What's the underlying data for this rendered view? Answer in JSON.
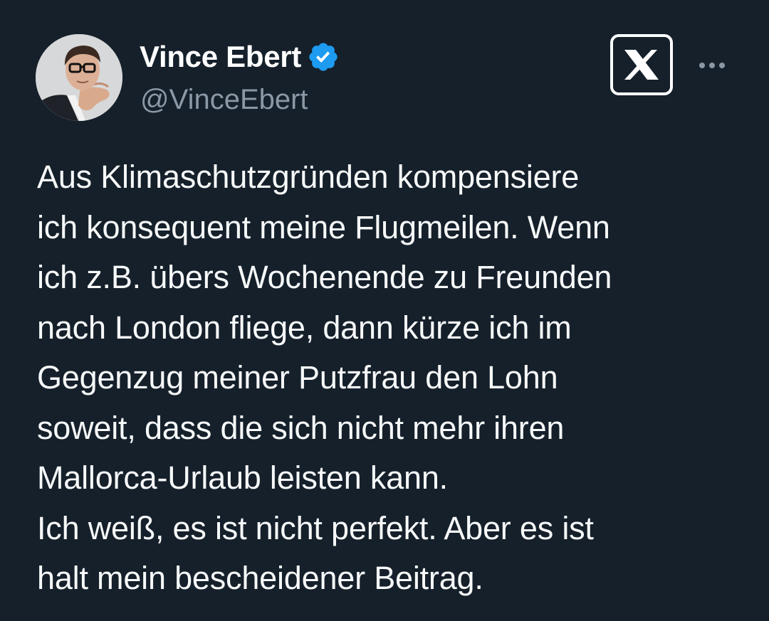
{
  "author": {
    "display_name": "Vince Ebert",
    "handle": "@VinceEbert",
    "verified": true,
    "avatar_icon": "profile-photo"
  },
  "header": {
    "logo_icon": "x-logo-icon",
    "more_icon": "more-options-icon"
  },
  "tweet": {
    "lines": [
      "Aus Klimaschutzgründen kompensiere",
      "ich konsequent meine Flugmeilen. Wenn",
      "ich z.B. übers Wochenende zu Freunden",
      "nach London fliege, dann kürze ich im",
      "Gegenzug meiner Putzfrau den Lohn",
      "soweit, dass die sich nicht mehr ihren",
      "Mallorca-Urlaub leisten kann.",
      "Ich weiß, es ist nicht perfekt. Aber es ist",
      "halt mein bescheidener Beitrag."
    ]
  },
  "colors": {
    "background": "#15202b",
    "text": "#f7f9f9",
    "secondary_text": "#8b98a5",
    "verified_blue": "#1d9bf0"
  }
}
